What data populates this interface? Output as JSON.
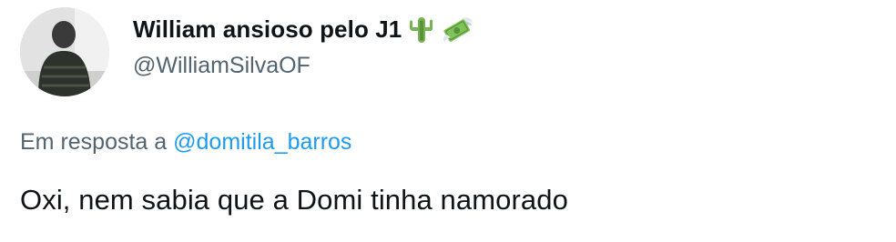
{
  "tweet": {
    "author": {
      "display_name": "William ansioso pelo J1",
      "emojis": [
        "cactus-emoji",
        "money-with-wings-emoji"
      ],
      "handle": "@WilliamSilvaOF"
    },
    "reply_context": {
      "prefix": "Em resposta a",
      "mention": "@domitila_barros"
    },
    "text": "Oxi, nem sabia que a Domi tinha namorado"
  },
  "colors": {
    "text_primary": "#0f1419",
    "text_secondary": "#536471",
    "link": "#1d9bf0",
    "background": "#ffffff"
  }
}
